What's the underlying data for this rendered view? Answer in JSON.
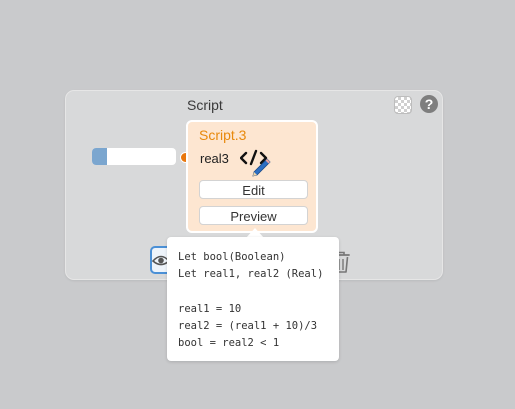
{
  "panel": {
    "title": "Script",
    "icons": [
      "transparency-checker-icon",
      "help-icon"
    ],
    "help_glyph": "?"
  },
  "script_card": {
    "name": "Script.3",
    "variable": "real3",
    "code_icon": "code-edit-icon",
    "edit_label": "Edit",
    "preview_label": "Preview",
    "accent_color": "#e8890c",
    "background_color": "#fde6d1"
  },
  "input_port": {
    "fill_color": "#7ba6cf",
    "port_color": "#e8760c"
  },
  "toolbar": {
    "eye_icon": "eye-icon",
    "trash_icon": "trash-icon"
  },
  "tooltip": {
    "lines": [
      "Let bool(Boolean)",
      "Let real1, real2 (Real)",
      "",
      "real1 = 10",
      "real2 = (real1 + 10)/3",
      "bool = real2 < 1"
    ]
  }
}
